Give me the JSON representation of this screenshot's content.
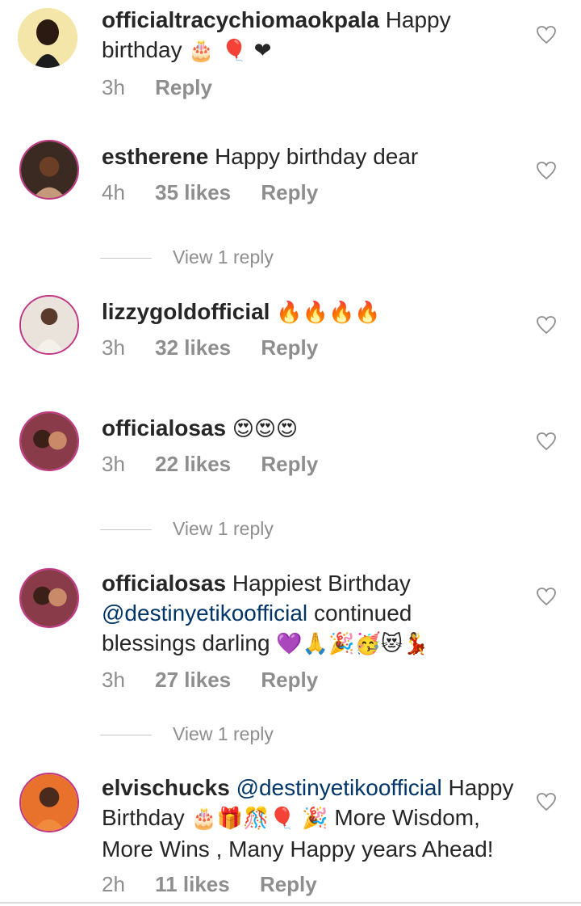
{
  "comments": [
    {
      "username": "officialtracychiomaokpala",
      "text": "Happy",
      "text2": "birthday",
      "emoji": "🎂 🎈 ❤",
      "time": "3h",
      "likes": "",
      "reply": "Reply"
    },
    {
      "username": "estherene",
      "text": "Happy birthday dear",
      "time": "4h",
      "likes": "35 likes",
      "reply": "Reply",
      "view_replies": "View 1 reply"
    },
    {
      "username": "lizzygoldofficial",
      "emoji": "🔥🔥🔥🔥",
      "time": "3h",
      "likes": "32 likes",
      "reply": "Reply"
    },
    {
      "username": "officialosas",
      "emoji": "😍😍😍",
      "time": "3h",
      "likes": "22 likes",
      "reply": "Reply",
      "view_replies": "View 1 reply"
    },
    {
      "username": "officialosas",
      "text": "Happiest Birthday",
      "mention": "@destinyetikoofficial",
      "text2": "continued",
      "text3": "blessings darling",
      "emoji": "💜🙏🎉🥳😻💃",
      "time": "3h",
      "likes": "27 likes",
      "reply": "Reply",
      "view_replies": "View 1 reply"
    },
    {
      "username": "elvischucks",
      "mention": "@destinyetikoofficial",
      "text": "Happy",
      "text2": "Birthday",
      "emoji": "🎂🎁🎊🎈 🎉",
      "text3": "More Wisdom,",
      "text4": "More Wins , Many Happy years Ahead!",
      "time": "2h",
      "likes": "11 likes",
      "reply": "Reply"
    }
  ],
  "icons": {
    "heart": "heart-outline-icon",
    "avatar": "profile-photo"
  },
  "colors": {
    "text": "#262626",
    "secondary": "#8e8e8e",
    "mention": "#003569",
    "ring": "#c13584"
  }
}
